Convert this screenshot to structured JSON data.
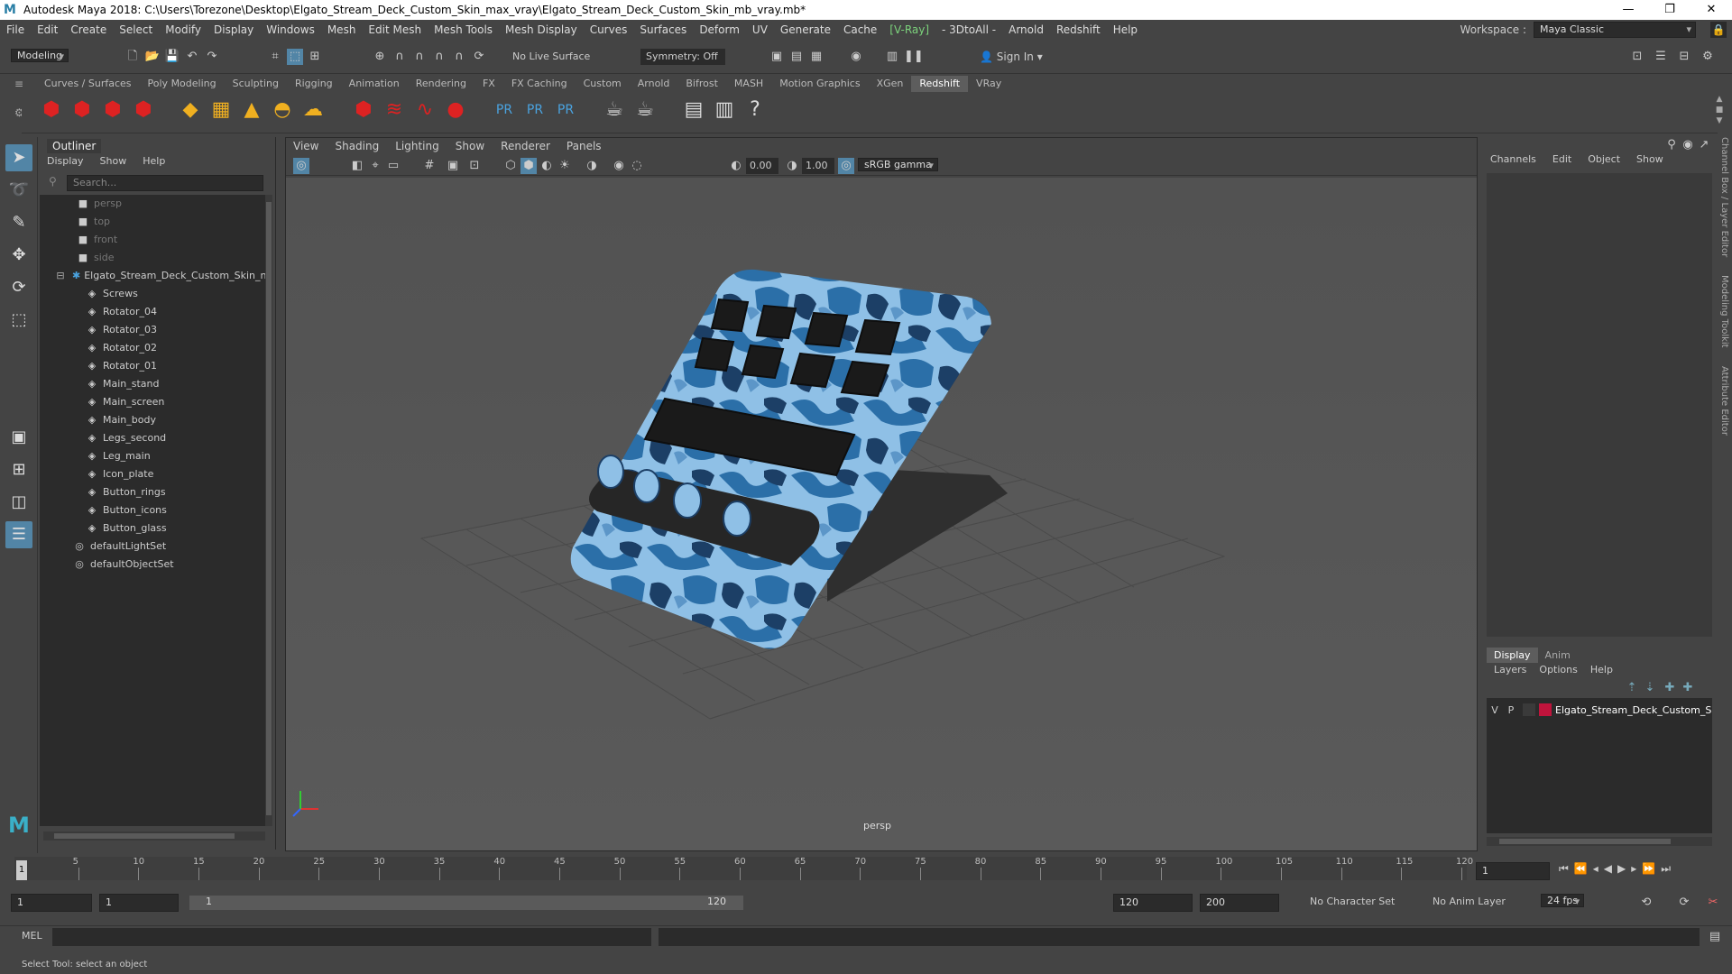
{
  "window": {
    "title": "Autodesk Maya 2018: C:\\Users\\Torezone\\Desktop\\Elgato_Stream_Deck_Custom_Skin_max_vray\\Elgato_Stream_Deck_Custom_Skin_mb_vray.mb*"
  },
  "menus": [
    "File",
    "Edit",
    "Create",
    "Select",
    "Modify",
    "Display",
    "Windows",
    "Mesh",
    "Edit Mesh",
    "Mesh Tools",
    "Mesh Display",
    "Curves",
    "Surfaces",
    "Deform",
    "UV",
    "Generate",
    "Cache",
    "[V-Ray]",
    "- 3DtoAll -",
    "Arnold",
    "Redshift",
    "Help"
  ],
  "workspace": {
    "label": "Workspace :",
    "value": "Maya Classic"
  },
  "status": {
    "mode": "Modeling",
    "live_surface": "No Live Surface",
    "symmetry": "Symmetry: Off",
    "sign_in": "Sign In"
  },
  "shelf_tabs": [
    "Curves / Surfaces",
    "Poly Modeling",
    "Sculpting",
    "Rigging",
    "Animation",
    "Rendering",
    "FX",
    "FX Caching",
    "Custom",
    "Arnold",
    "Bifrost",
    "MASH",
    "Motion Graphics",
    "XGen",
    "Redshift",
    "VRay"
  ],
  "shelf_active": "Redshift",
  "outliner": {
    "title": "Outliner",
    "menu": [
      "Display",
      "Show",
      "Help"
    ],
    "search_placeholder": "Search...",
    "cameras": [
      "persp",
      "top",
      "front",
      "side"
    ],
    "root": "Elgato_Stream_Deck_Custom_Skin_nc",
    "children": [
      "Screws",
      "Rotator_04",
      "Rotator_03",
      "Rotator_02",
      "Rotator_01",
      "Main_stand",
      "Main_screen",
      "Main_body",
      "Legs_second",
      "Leg_main",
      "Icon_plate",
      "Button_rings",
      "Button_icons",
      "Button_glass"
    ],
    "sets": [
      "defaultLightSet",
      "defaultObjectSet"
    ]
  },
  "viewport": {
    "menu": [
      "View",
      "Shading",
      "Lighting",
      "Show",
      "Renderer",
      "Panels"
    ],
    "exposure": "0.00",
    "gamma": "1.00",
    "color_space": "sRGB gamma",
    "camera_label": "persp"
  },
  "channel_box": {
    "tabs": [
      "Channels",
      "Edit",
      "Object",
      "Show"
    ]
  },
  "layer_editor": {
    "tabs": [
      "Display",
      "Anim"
    ],
    "menu": [
      "Layers",
      "Options",
      "Help"
    ],
    "layer": {
      "v": "V",
      "p": "P",
      "name": "Elgato_Stream_Deck_Custom_S",
      "color": "#c0143c"
    }
  },
  "side_tabs": [
    "Channel Box / Layer Editor",
    "Modeling Toolkit",
    "Attribute Editor"
  ],
  "timeline": {
    "ticks": [
      "5",
      "10",
      "15",
      "20",
      "25",
      "30",
      "35",
      "40",
      "45",
      "50",
      "55",
      "60",
      "65",
      "70",
      "75",
      "80",
      "85",
      "90",
      "95",
      "100",
      "105",
      "110",
      "115",
      "120"
    ],
    "first": "1",
    "current": "1"
  },
  "range": {
    "start": "1",
    "start2": "1",
    "slider_start": "1",
    "slider_end": "120",
    "end": "120",
    "end2": "200",
    "char_set": "No Character Set",
    "anim_layer": "No Anim Layer",
    "fps": "24 fps"
  },
  "mel": {
    "label": "MEL"
  },
  "help_line": "Select Tool: select an object"
}
